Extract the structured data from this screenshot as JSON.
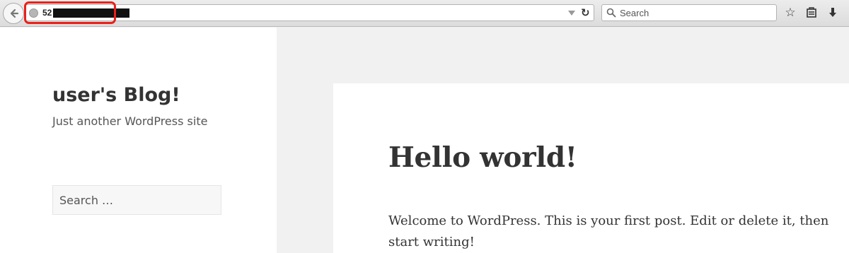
{
  "browser": {
    "url_visible": "52",
    "search_placeholder": "Search",
    "highlight_color": "#e8211a",
    "icons": [
      "back-arrow-icon",
      "globe-icon",
      "dropdown-arrow-icon",
      "reload-icon",
      "search-icon",
      "bookmark-star-icon",
      "reading-list-icon",
      "download-icon"
    ]
  },
  "sidebar": {
    "site_title": "user's Blog!",
    "site_description": "Just another WordPress site",
    "search_placeholder": "Search …"
  },
  "post": {
    "title": "Hello world!",
    "body": "Welcome to WordPress. This is your first post. Edit or delete it, then start writing!"
  }
}
